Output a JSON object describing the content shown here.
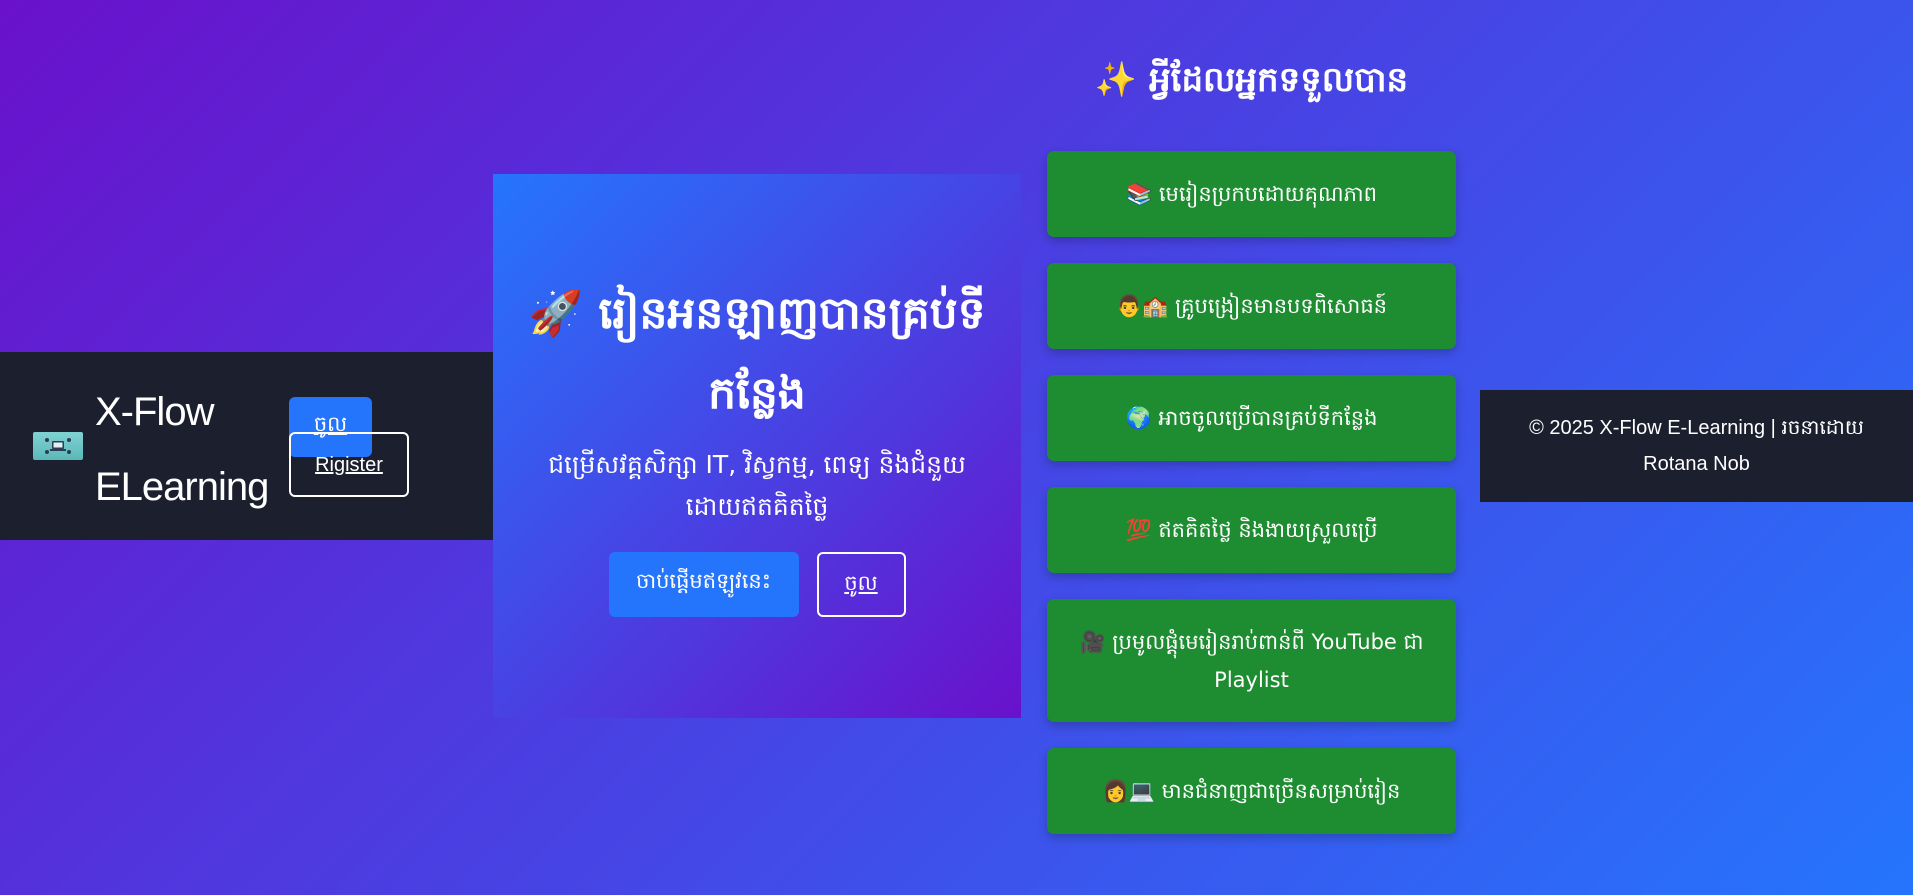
{
  "header": {
    "brand_line1": "X-Flow",
    "brand_line2": "ELearning",
    "login_label": "ចូល",
    "register_label": "Rigister"
  },
  "hero": {
    "title": "🚀 រៀនអនឡាញបានគ្រប់ទីកន្លែង",
    "subtitle": "ជម្រើសវគ្គសិក្សា IT, វិស្វកម្ម, ពេទ្យ និងជំនួយដោយឥតគិតថ្លៃ",
    "start_button": "ចាប់ផ្តើមឥឡូវនេះ",
    "login_button": "ចូល"
  },
  "features": {
    "title": "✨ អ្វីដែលអ្នកទទួលបាន",
    "items": [
      "📚 មេរៀនប្រកបដោយគុណភាព",
      "👨‍🏫 គ្រូបង្រៀនមានបទពិសោធន៍",
      "🌍 អាចចូលប្រើបានគ្រប់ទីកន្លែង",
      "💯 ឥតគិតថ្លៃ និងងាយស្រួលប្រើ",
      "🎥 ប្រមូលផ្តុំមេរៀនរាប់ពាន់ពី YouTube ជា Playlist",
      "👩‍💻 មានជំនាញជាច្រើនសម្រាប់រៀន"
    ]
  },
  "footer": {
    "text": "© 2025 X-Flow E-Learning | រចនាដោយ Rotana Nob"
  },
  "colors": {
    "gradient_start": "#6a11cb",
    "gradient_end": "#2575fc",
    "header_bg": "#1c1f2e",
    "feature_bg": "#1e8c30",
    "primary_button": "#2575fc"
  },
  "icons": {
    "logo": "logo-image"
  }
}
